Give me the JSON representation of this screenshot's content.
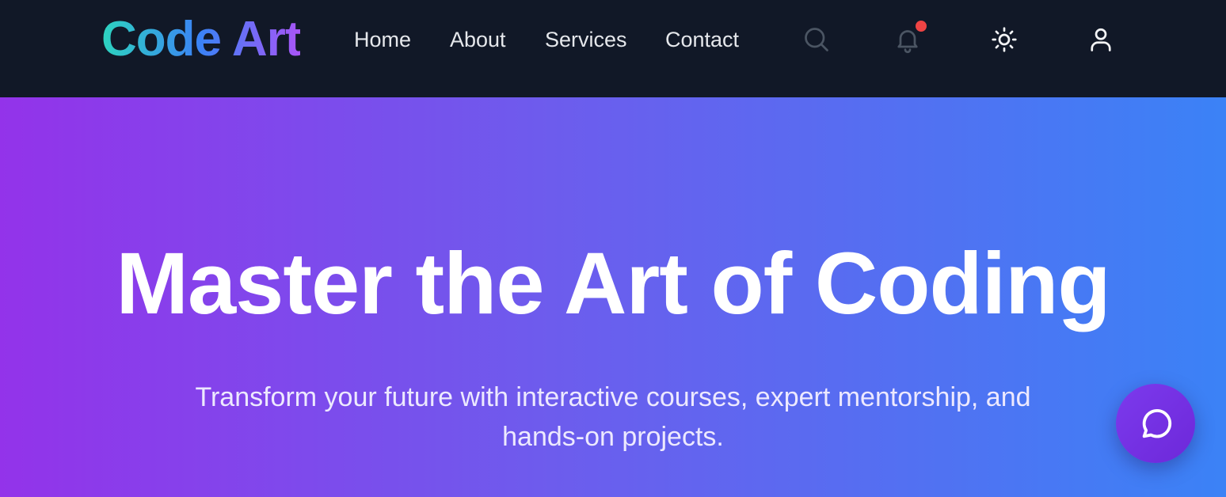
{
  "header": {
    "logo": "Code Art",
    "nav": [
      {
        "label": "Home"
      },
      {
        "label": "About"
      },
      {
        "label": "Services"
      },
      {
        "label": "Contact"
      }
    ],
    "icons": {
      "search": "search-icon",
      "notifications": "bell-icon",
      "theme": "sun-icon",
      "account": "user-icon"
    },
    "notification_dot_color": "#ef4444"
  },
  "hero": {
    "title": "Master the Art of Coding",
    "subtitle": "Transform your future with interactive courses, expert mentorship, and hands-on projects.",
    "chat_icon": "chat-bubble-icon"
  },
  "colors": {
    "nav_background": "#111827",
    "logo_gradient": [
      "#2dd4bf",
      "#3b82f6",
      "#a855f7"
    ],
    "hero_gradient": [
      "#9333ea",
      "#3b82f6"
    ],
    "chat_button": "#7c3aed"
  }
}
